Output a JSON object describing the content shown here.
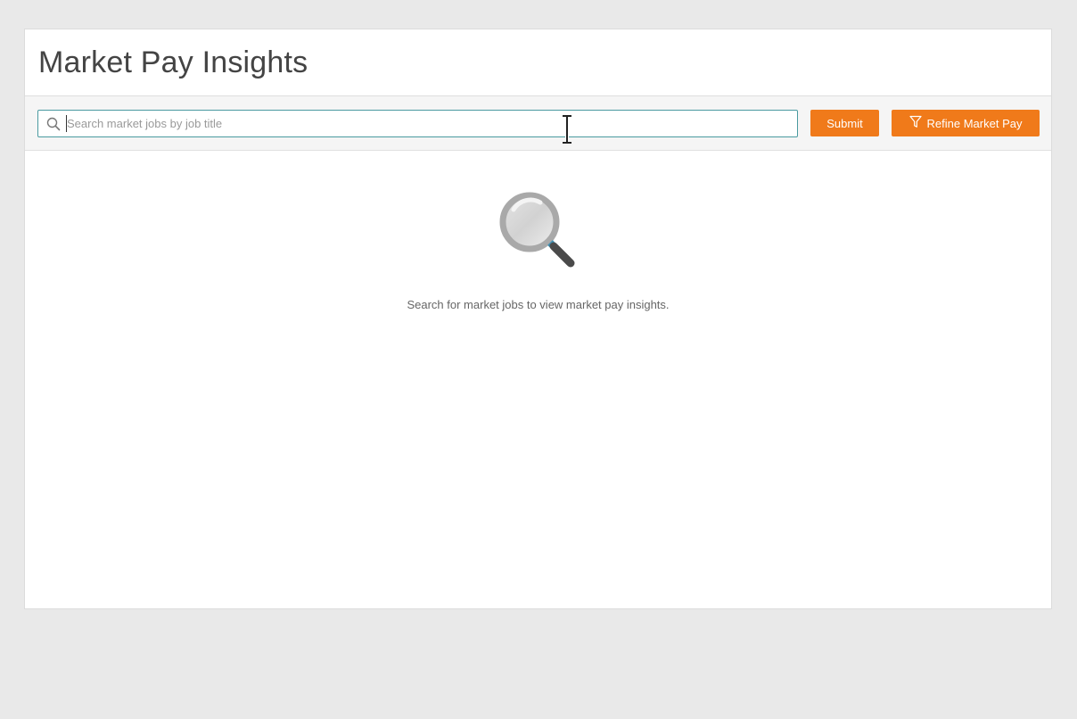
{
  "header": {
    "title": "Market Pay Insights"
  },
  "toolbar": {
    "search_placeholder": "Search market jobs by job title",
    "search_value": "",
    "submit_label": "Submit",
    "refine_label": "Refine Market Pay"
  },
  "empty_state": {
    "message": "Search for market jobs to view market pay insights.",
    "icon": "magnifier-icon"
  },
  "colors": {
    "accent": "#f07a1a",
    "focus_border": "#4a9aa0",
    "page_background": "#e9e9e9"
  }
}
